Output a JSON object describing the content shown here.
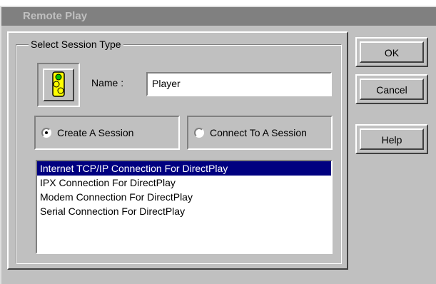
{
  "window": {
    "title": "Remote Play"
  },
  "group": {
    "legend": "Select Session Type"
  },
  "player": {
    "name_label": "Name :",
    "name_value": "Player",
    "icon": "traffic-light-icon"
  },
  "session": {
    "create_label": "Create A Session",
    "create_selected": true,
    "connect_label": "Connect To A Session",
    "connect_selected": false
  },
  "connections": [
    {
      "label": "Internet TCP/IP Connection For DirectPlay",
      "selected": true
    },
    {
      "label": "IPX Connection For DirectPlay",
      "selected": false
    },
    {
      "label": "Modem Connection For DirectPlay",
      "selected": false
    },
    {
      "label": "Serial Connection For DirectPlay",
      "selected": false
    }
  ],
  "buttons": {
    "ok": "OK",
    "cancel": "Cancel",
    "help": "Help"
  },
  "colors": {
    "face": "#c0c0c0",
    "selection": "#000080",
    "titlebar": "#808080"
  }
}
